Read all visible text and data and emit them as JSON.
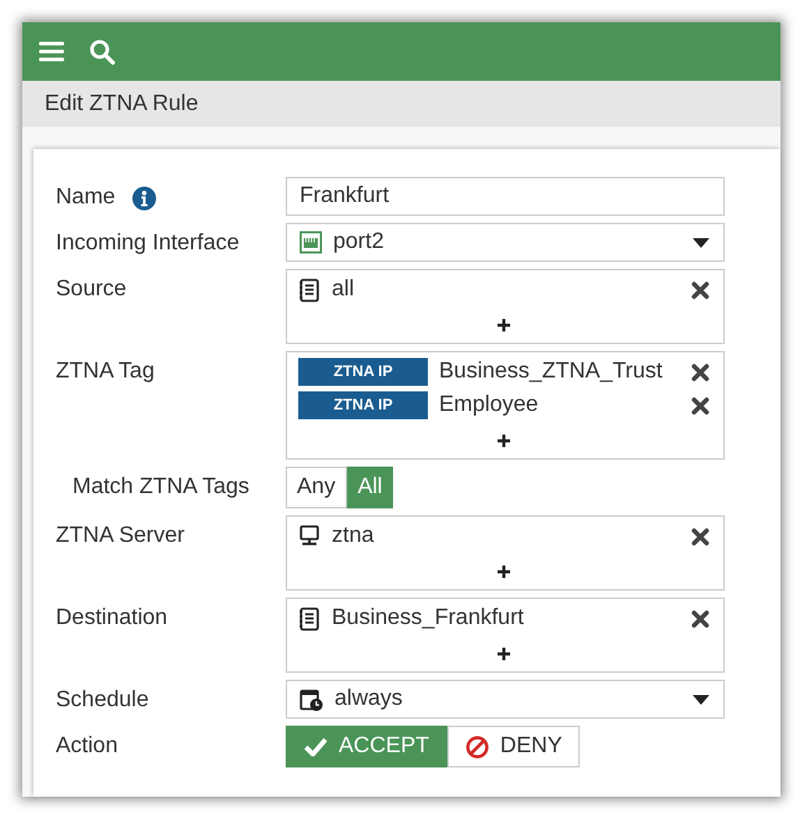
{
  "page_title": "Edit ZTNA Rule",
  "name": {
    "label": "Name",
    "value": "Frankfurt"
  },
  "incoming_interface": {
    "label": "Incoming Interface",
    "value": "port2"
  },
  "source": {
    "label": "Source",
    "items": [
      {
        "label": "all"
      }
    ]
  },
  "ztna_tag": {
    "label": "ZTNA Tag",
    "items": [
      {
        "tag": "ZTNA IP",
        "label": "Business_ZTNA_Trust"
      },
      {
        "tag": "ZTNA IP",
        "label": "Employee"
      }
    ]
  },
  "match_ztna_tags": {
    "label": "Match ZTNA Tags",
    "options": [
      {
        "label": "Any",
        "selected": false
      },
      {
        "label": "All",
        "selected": true
      }
    ]
  },
  "ztna_server": {
    "label": "ZTNA Server",
    "items": [
      {
        "label": "ztna"
      }
    ]
  },
  "destination": {
    "label": "Destination",
    "items": [
      {
        "label": "Business_Frankfurt"
      }
    ]
  },
  "schedule": {
    "label": "Schedule",
    "value": "always"
  },
  "action": {
    "label": "Action",
    "options": [
      {
        "kind": "accept",
        "label": "ACCEPT",
        "selected": true
      },
      {
        "kind": "deny",
        "label": "DENY",
        "selected": false
      }
    ]
  }
}
